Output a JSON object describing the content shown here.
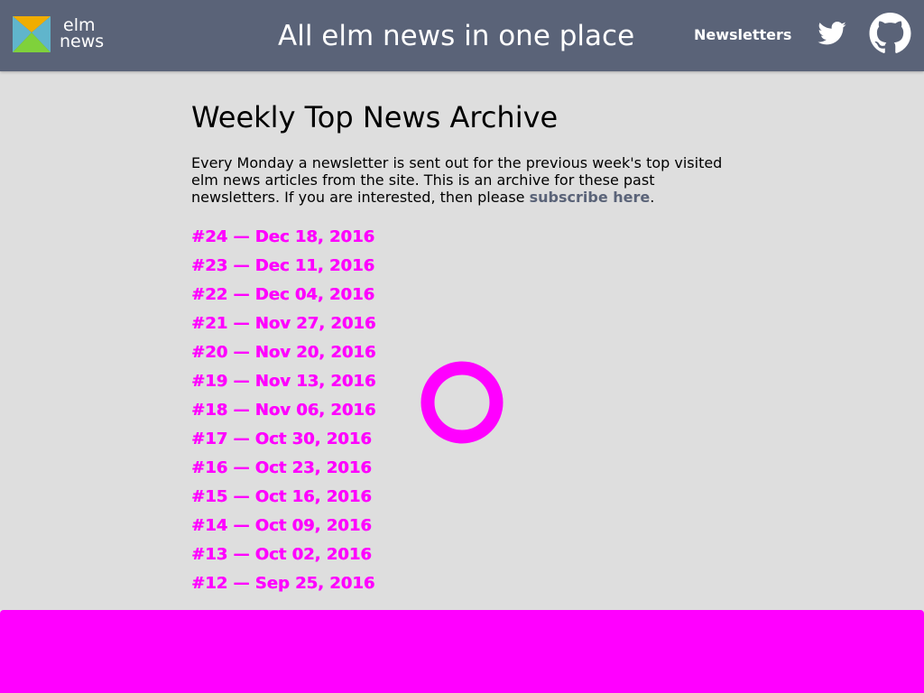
{
  "header": {
    "logo_line1": "elm",
    "logo_line2": "news",
    "site_title": "All elm news in one place",
    "nav_newsletters": "Newsletters",
    "icons": {
      "logo": "elm-news-logo-icon",
      "twitter": "twitter-icon",
      "github": "github-icon"
    }
  },
  "main": {
    "title": "Weekly Top News Archive",
    "intro_text": "Every Monday a newsletter is sent out for the previous week's top visited elm news articles from the site. This is an archive for these past newsletters. If you are interested, then please ",
    "subscribe_link": "subscribe here",
    "intro_end": "."
  },
  "archive": [
    "#24 — Dec 18, 2016",
    "#23 — Dec 11, 2016",
    "#22 — Dec 04, 2016",
    "#21 — Nov 27, 2016",
    "#20 — Nov 20, 2016",
    "#19 — Nov 13, 2016",
    "#18 — Nov 06, 2016",
    "#17 — Oct 30, 2016",
    "#16 — Oct 23, 2016",
    "#15 — Oct 16, 2016",
    "#14 — Oct 09, 2016",
    "#13 — Oct 02, 2016",
    "#12 — Sep 25, 2016"
  ],
  "colors": {
    "header_bg": "#5a6378",
    "page_bg": "#dedede",
    "link_magenta": "#ff00ff",
    "subscribe_link": "#5a6378",
    "logo_orange": "#f0ad00",
    "logo_green": "#7fd13b",
    "logo_blue": "#60b5cc"
  }
}
